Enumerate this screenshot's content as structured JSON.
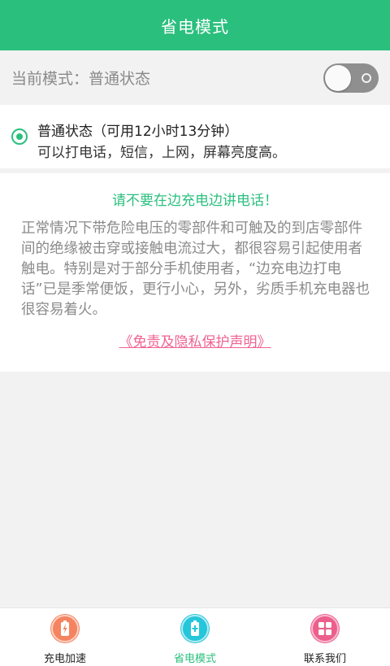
{
  "header": {
    "title": "省电模式"
  },
  "mode": {
    "label": "当前模式：普通状态",
    "toggle_on": false
  },
  "state_card": {
    "title": "普通状态（可用12小时13分钟）",
    "description": "可以打电话，短信，上网，屏幕亮度高。"
  },
  "warning": {
    "title": "请不要在边充电边讲电话！",
    "body": "正常情况下带危险电压的零部件和可触及的到店零部件间的绝缘被击穿或接触电流过大，都很容易引起使用者触电。特别是对于部分手机使用者，“边充电边打电话”已是季常便饭，更行小心，另外，劣质手机充电器也很容易着火。",
    "link": "《免责及隐私保护声明》"
  },
  "tabs": [
    {
      "label": "充电加速",
      "icon": "battery-charge-icon",
      "color": "#f4845f",
      "active": false
    },
    {
      "label": "省电模式",
      "icon": "battery-save-icon",
      "color": "#26c6da",
      "active": true
    },
    {
      "label": "联系我们",
      "icon": "grid-icon",
      "color": "#ec5f8c",
      "active": false
    }
  ],
  "colors": {
    "accent": "#2bbf7e",
    "link": "#f06292"
  }
}
